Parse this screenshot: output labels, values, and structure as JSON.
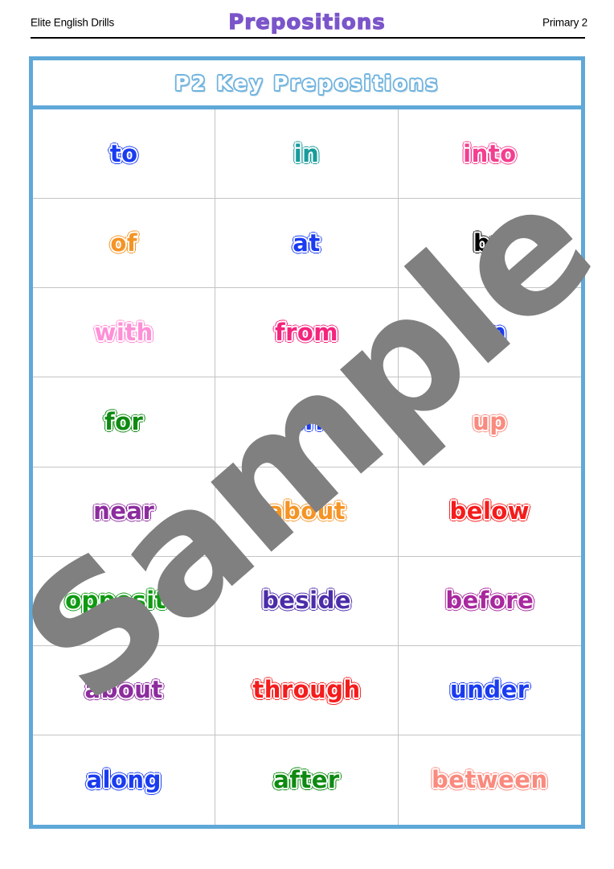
{
  "header": {
    "left_label": "Elite English Drills",
    "center_title": "Prepositions",
    "right_label": "Primary 2"
  },
  "worksheet": {
    "title": "P2 Key Prepositions",
    "border_color": "#5FA8D8",
    "grid_line_color": "#c4c4c4",
    "columns": 3,
    "rows": 8,
    "words": [
      {
        "text": "to",
        "color": "#1A3CF0"
      },
      {
        "text": "in",
        "color": "#199B9B"
      },
      {
        "text": "into",
        "color": "#F43E8F"
      },
      {
        "text": "of",
        "color": "#F59425"
      },
      {
        "text": "at",
        "color": "#1A3CF0"
      },
      {
        "text": "by",
        "color": "#000000"
      },
      {
        "text": "with",
        "color": "#FF8FD6"
      },
      {
        "text": "from",
        "color": "#F4247D"
      },
      {
        "text": "on",
        "color": "#1A3CF0"
      },
      {
        "text": "for",
        "color": "#0E8A12"
      },
      {
        "text": "off",
        "color": "#1A3CF0"
      },
      {
        "text": "up",
        "color": "#FA8A7E"
      },
      {
        "text": "near",
        "color": "#8C2C9E"
      },
      {
        "text": "about",
        "color": "#F59425"
      },
      {
        "text": "below",
        "color": "#F41C1C"
      },
      {
        "text": "opposite",
        "color": "#0E9A12"
      },
      {
        "text": "beside",
        "color": "#4B2CA8"
      },
      {
        "text": "before",
        "color": "#A8289E"
      },
      {
        "text": "about",
        "color": "#8C2C9E"
      },
      {
        "text": "through",
        "color": "#F41C1C"
      },
      {
        "text": "under",
        "color": "#1A3CF0"
      },
      {
        "text": "along",
        "color": "#1A3CF0"
      },
      {
        "text": "after",
        "color": "#0E8A12"
      },
      {
        "text": "between",
        "color": "#FA8A7E"
      }
    ]
  },
  "watermark": {
    "text": "Sample",
    "color": "#808080"
  }
}
